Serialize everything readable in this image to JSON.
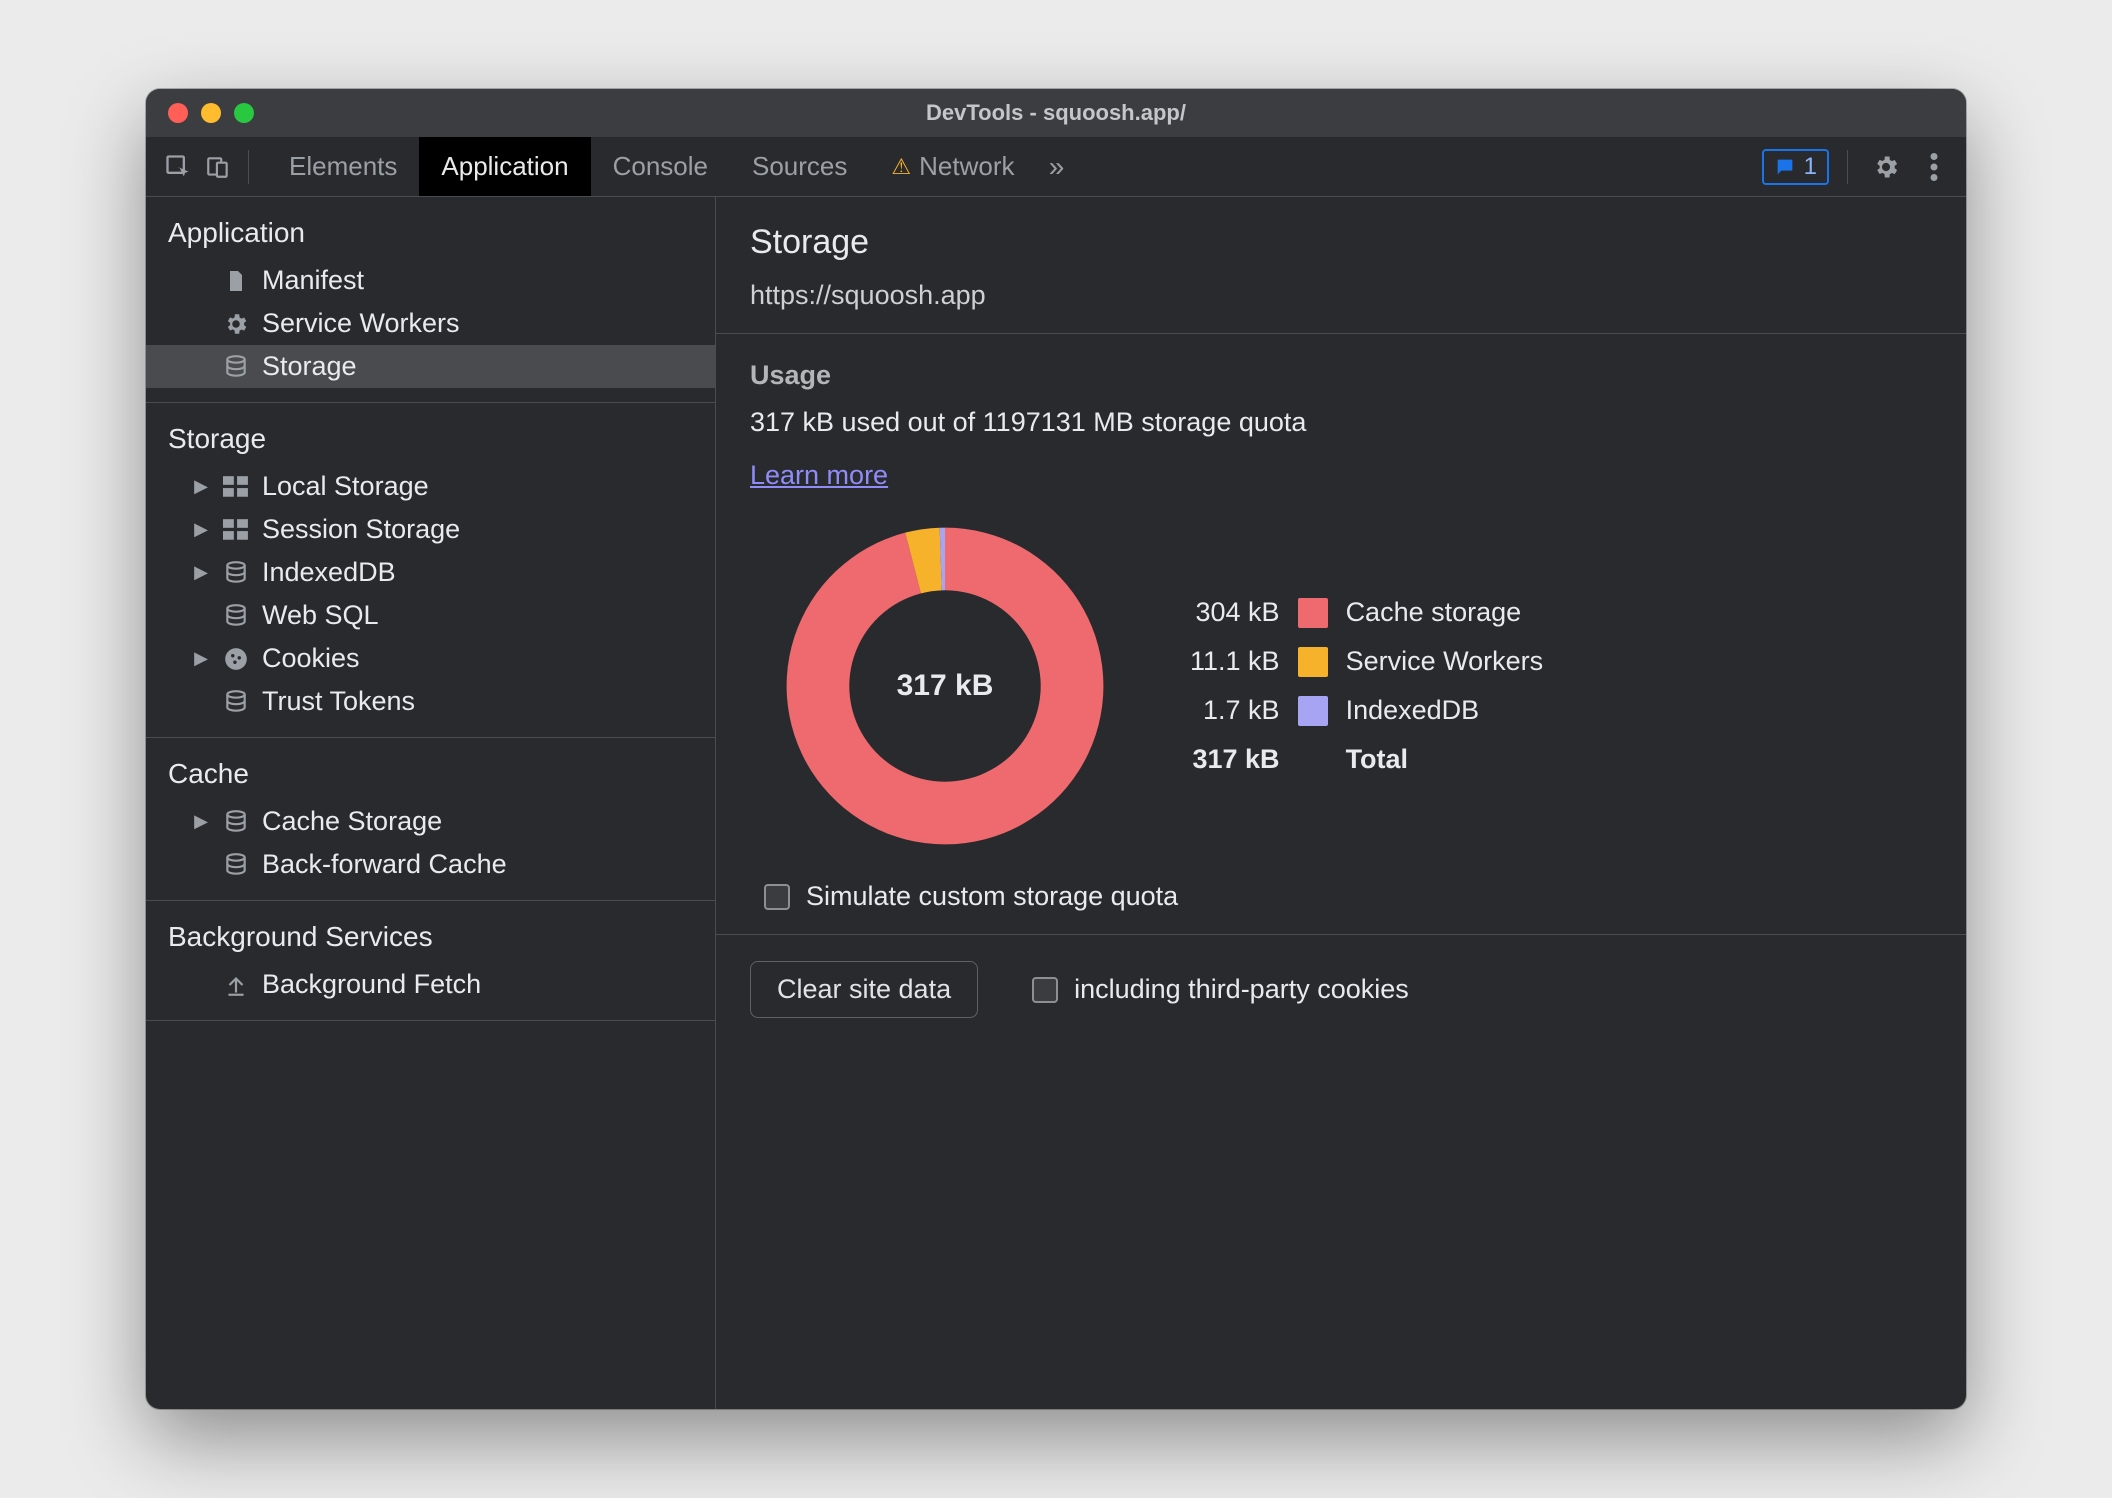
{
  "window": {
    "title": "DevTools - squoosh.app/"
  },
  "toolbar": {
    "tabs": [
      {
        "label": "Elements"
      },
      {
        "label": "Application"
      },
      {
        "label": "Console"
      },
      {
        "label": "Sources"
      },
      {
        "label": "Network",
        "warn": true
      }
    ],
    "active_index": 1,
    "messages_count": "1"
  },
  "sidebar": {
    "groups": [
      {
        "title": "Application",
        "items": [
          {
            "label": "Manifest",
            "icon": "file",
            "caret": "none"
          },
          {
            "label": "Service Workers",
            "icon": "gear",
            "caret": "none"
          },
          {
            "label": "Storage",
            "icon": "db",
            "caret": "none",
            "selected": true
          }
        ]
      },
      {
        "title": "Storage",
        "items": [
          {
            "label": "Local Storage",
            "icon": "grid",
            "caret": "closed"
          },
          {
            "label": "Session Storage",
            "icon": "grid",
            "caret": "closed"
          },
          {
            "label": "IndexedDB",
            "icon": "db",
            "caret": "closed"
          },
          {
            "label": "Web SQL",
            "icon": "db",
            "caret": "none"
          },
          {
            "label": "Cookies",
            "icon": "cookie",
            "caret": "closed"
          },
          {
            "label": "Trust Tokens",
            "icon": "db",
            "caret": "none"
          }
        ]
      },
      {
        "title": "Cache",
        "items": [
          {
            "label": "Cache Storage",
            "icon": "db",
            "caret": "closed"
          },
          {
            "label": "Back-forward Cache",
            "icon": "db",
            "caret": "none"
          }
        ]
      },
      {
        "title": "Background Services",
        "items": [
          {
            "label": "Background Fetch",
            "icon": "upload",
            "caret": "none"
          }
        ]
      }
    ]
  },
  "main": {
    "title": "Storage",
    "url": "https://squoosh.app",
    "usage": {
      "heading": "Usage",
      "text": "317 kB used out of 1197131 MB storage quota",
      "learn_more": "Learn more",
      "total_label": "317 kB",
      "simulate_label": "Simulate custom storage quota",
      "legend": [
        {
          "size": "304 kB",
          "label": "Cache storage",
          "color": "#ee6a6f"
        },
        {
          "size": "11.1 kB",
          "label": "Service Workers",
          "color": "#f7b22c"
        },
        {
          "size": "1.7 kB",
          "label": "IndexedDB",
          "color": "#a7a4f4"
        }
      ],
      "total_row": {
        "size": "317 kB",
        "label": "Total"
      }
    },
    "clear": {
      "button": "Clear site data",
      "checkbox": "including third-party cookies"
    }
  },
  "chart_data": {
    "type": "pie",
    "title": "Storage usage breakdown",
    "categories": [
      "Cache storage",
      "Service Workers",
      "IndexedDB"
    ],
    "values": [
      304,
      11.1,
      1.7
    ],
    "unit": "kB",
    "total": 317,
    "colors": [
      "#ee6a6f",
      "#f7b22c",
      "#a7a4f4"
    ]
  }
}
